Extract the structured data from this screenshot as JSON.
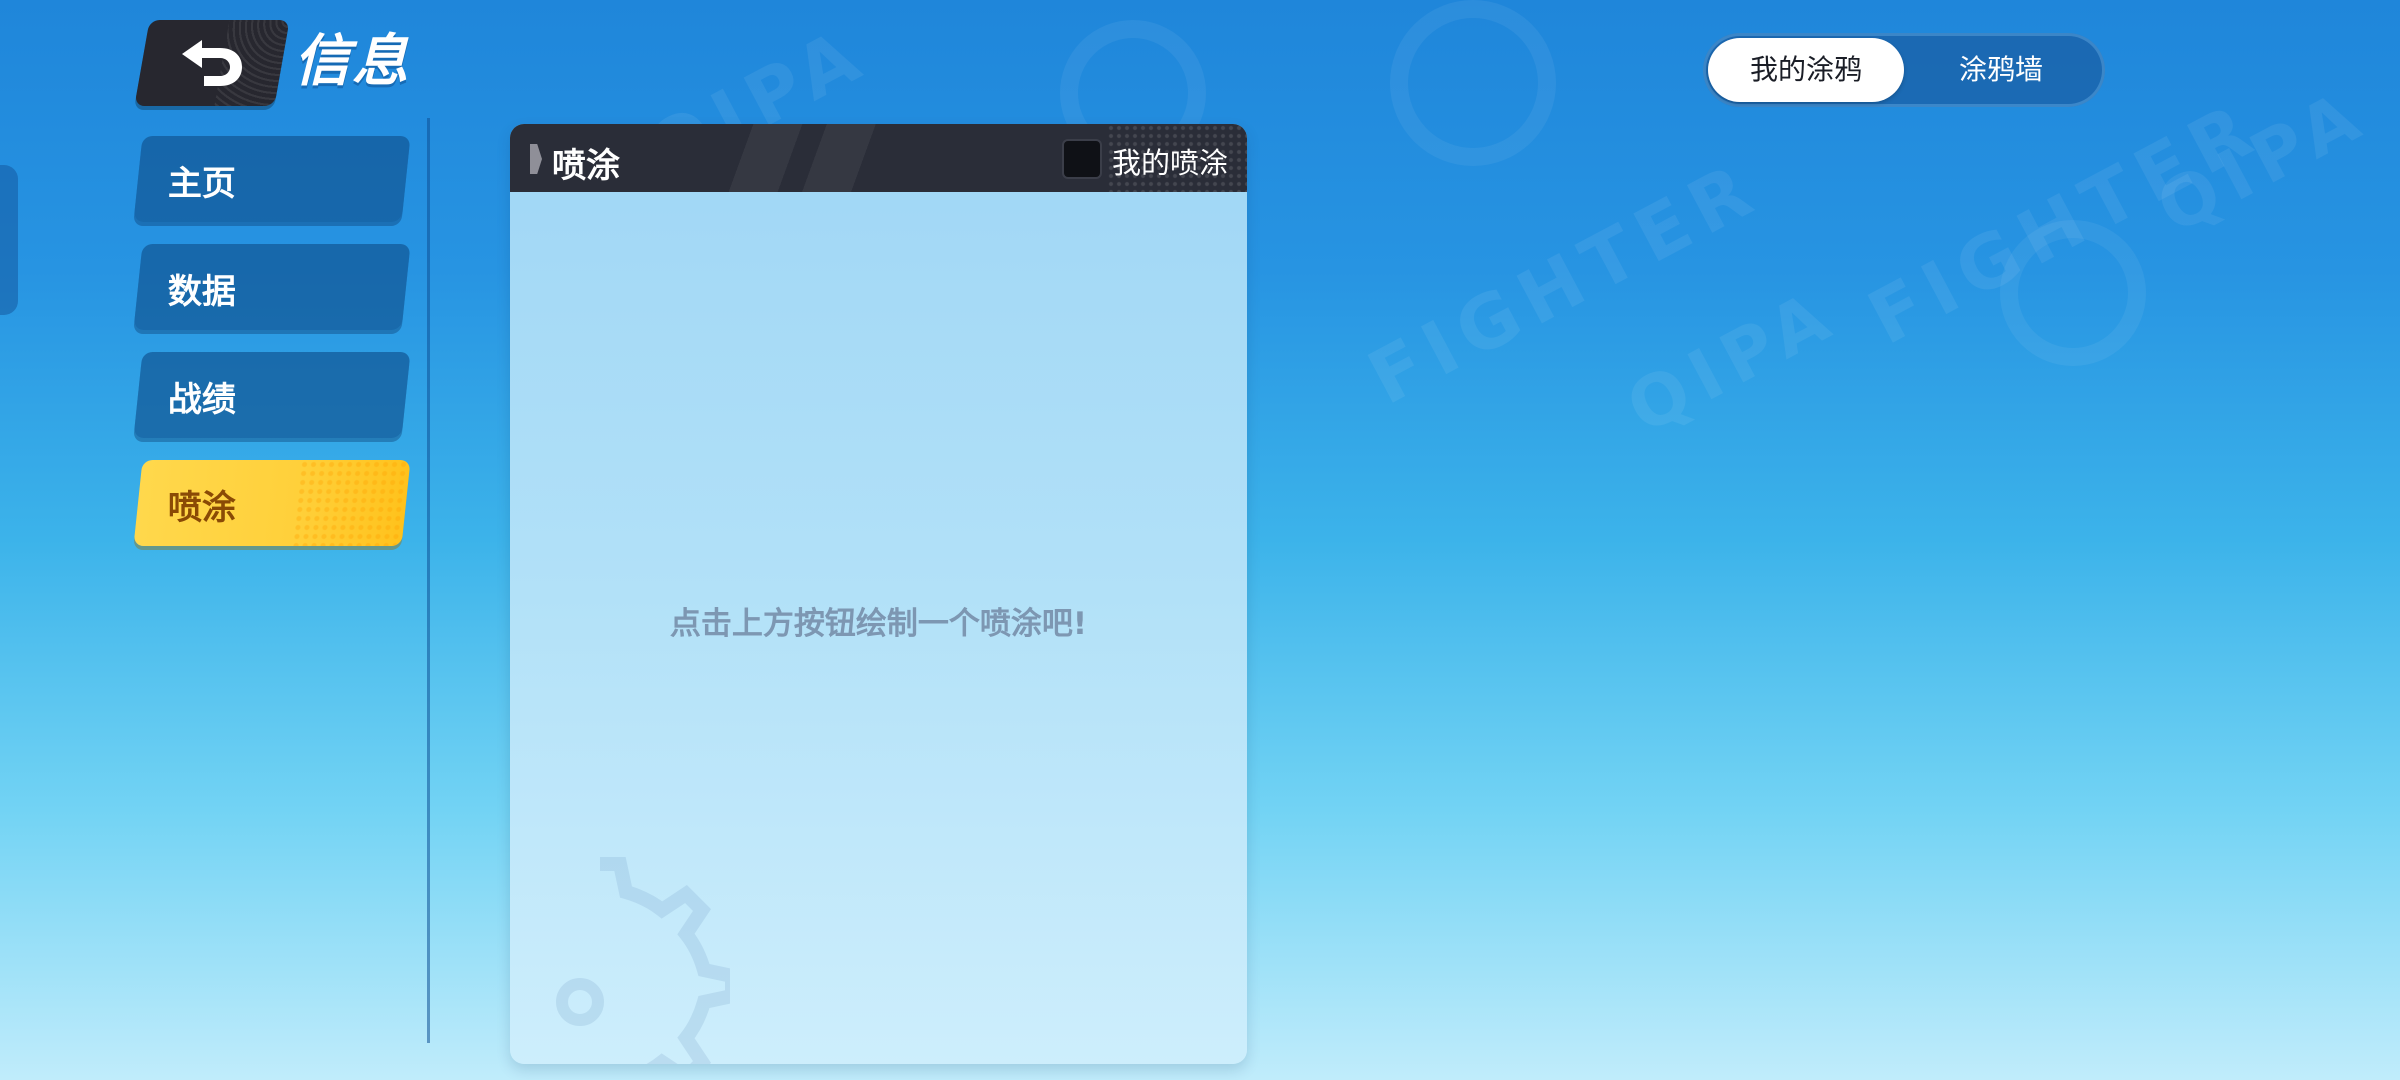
{
  "header": {
    "title": "信息",
    "back_icon": "back-arrow-icon"
  },
  "sidebar": {
    "items": [
      {
        "label": "主页",
        "active": false
      },
      {
        "label": "数据",
        "active": false
      },
      {
        "label": "战绩",
        "active": false
      },
      {
        "label": "喷涂",
        "active": true
      }
    ]
  },
  "panel": {
    "title": "喷涂",
    "filter_label": "我的喷涂",
    "filter_checked": false,
    "empty_message": "点击上方按钮绘制一个喷涂吧!"
  },
  "toggle": {
    "options": [
      {
        "label": "我的涂鸦",
        "selected": true
      },
      {
        "label": "涂鸦墙",
        "selected": false
      }
    ]
  },
  "colors": {
    "background_top": "#1f86da",
    "background_bottom": "#c0ecfb",
    "active_tab": "#ffd03a",
    "panel_header": "#2a2d38"
  }
}
